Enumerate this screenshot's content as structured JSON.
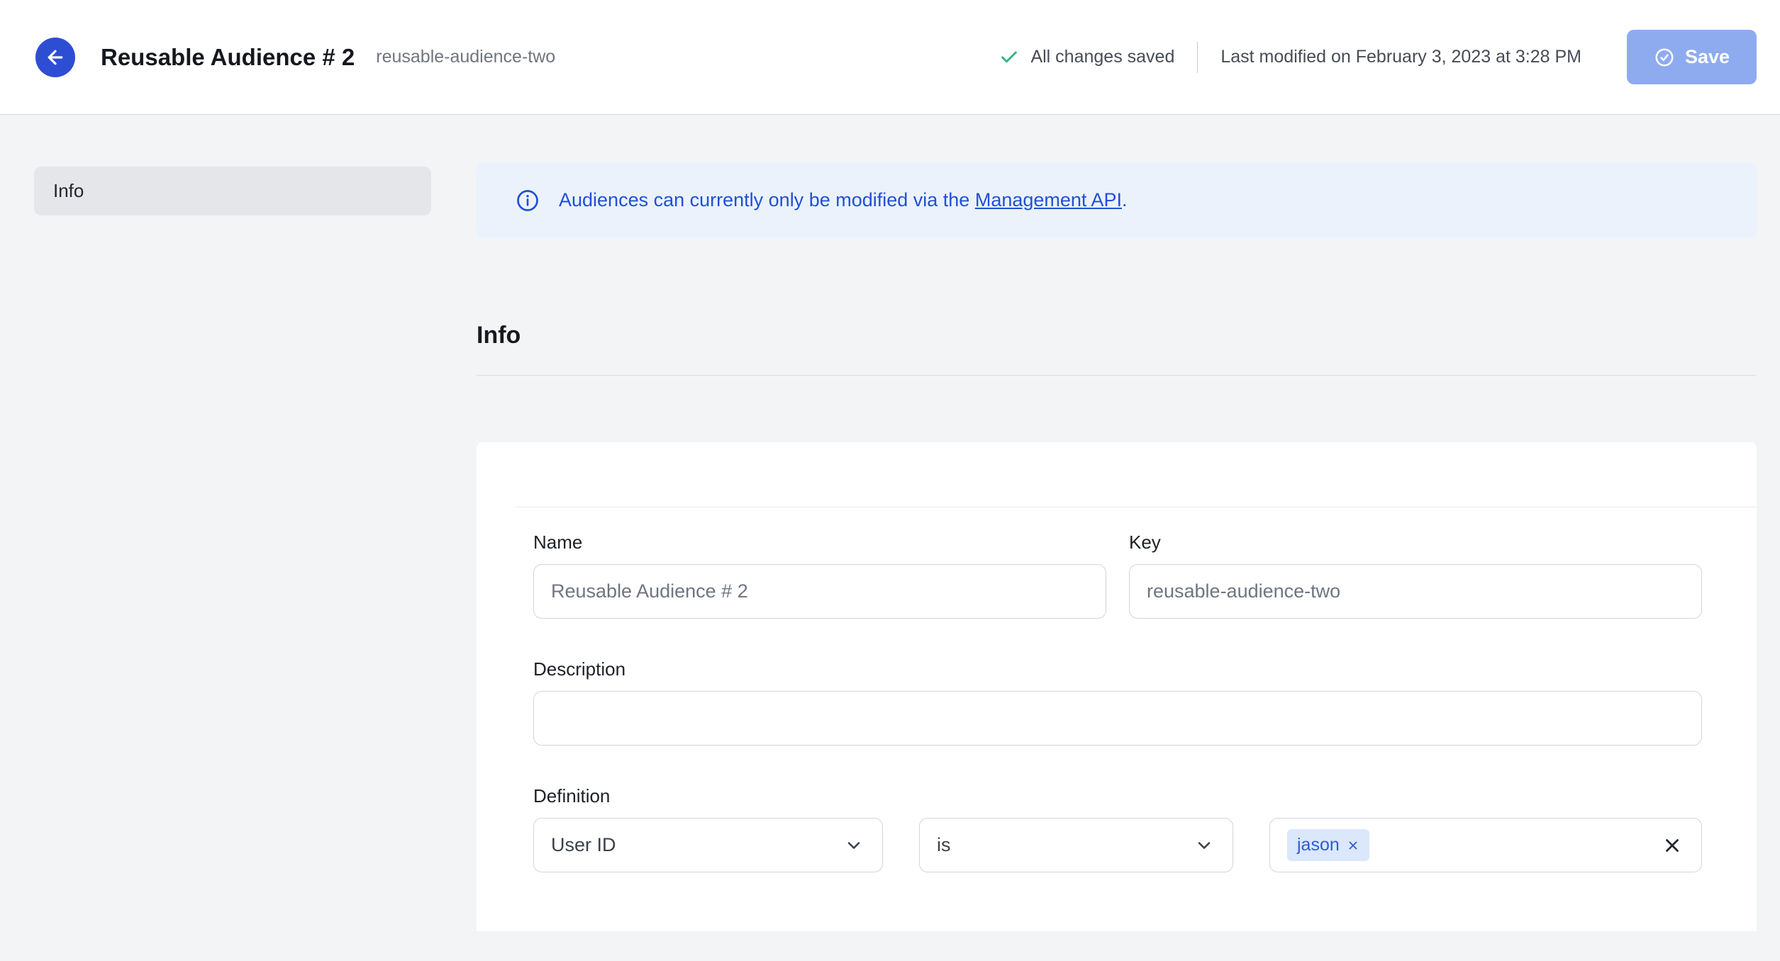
{
  "header": {
    "title": "Reusable Audience # 2",
    "slug": "reusable-audience-two",
    "status": "All changes saved",
    "last_modified": "Last modified on February 3, 2023 at 3:28 PM",
    "save_label": "Save"
  },
  "sidebar": {
    "items": [
      {
        "label": "Info",
        "active": true
      }
    ]
  },
  "banner": {
    "text_before": "Audiences can currently only be modified via the ",
    "link_label": "Management API",
    "text_after": "."
  },
  "section": {
    "title": "Info"
  },
  "form": {
    "name": {
      "label": "Name",
      "value": "Reusable Audience # 2"
    },
    "key": {
      "label": "Key",
      "value": "reusable-audience-two"
    },
    "description": {
      "label": "Description",
      "value": ""
    },
    "definition": {
      "label": "Definition",
      "trait_selected": "User ID",
      "operator_selected": "is",
      "tags": [
        "jason"
      ]
    }
  },
  "icons": {
    "back": "arrow-left",
    "saved_check": "check",
    "save": "circle-check",
    "banner_info": "info-circle",
    "select_caret": "chevron-down",
    "chip_remove": "x",
    "tags_clear": "x"
  },
  "colors": {
    "accent_blue": "#2d4ed3",
    "save_disabled_bg": "#8fabef",
    "success_green": "#3eb483",
    "banner_bg": "#ebf2fc",
    "banner_text": "#2150d6",
    "chip_bg": "#dbe7fb",
    "chip_text": "#2e5cd6",
    "page_bg": "#f3f4f6",
    "card_bg": "#ffffff"
  }
}
